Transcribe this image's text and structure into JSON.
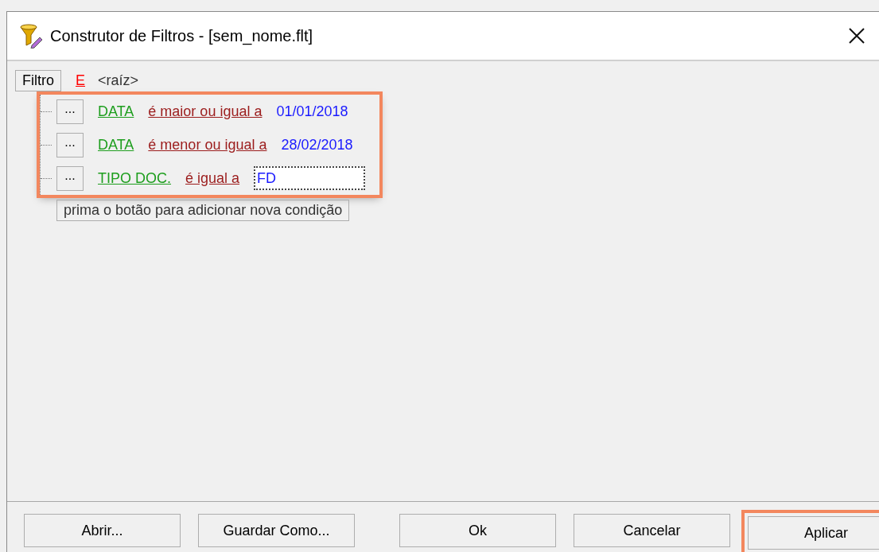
{
  "window": {
    "title": "Construtor de Filtros - [sem_nome.flt]"
  },
  "root": {
    "label": "Filtro",
    "operator": "E",
    "name": "<raíz>"
  },
  "conditions": {
    "highlighted": true,
    "items": [
      {
        "kind": "text",
        "button": "...",
        "field": "DATA",
        "operator": "é maior ou igual a",
        "value": "01/01/2018"
      },
      {
        "kind": "text",
        "button": "...",
        "field": "DATA",
        "operator": "é menor ou igual a",
        "value": "28/02/2018"
      },
      {
        "kind": "input",
        "button": "...",
        "field": "TIPO DOC.",
        "operator": "é igual a",
        "value": "FD"
      }
    ]
  },
  "add_hint": "prima o botão para adicionar nova condição",
  "buttons": [
    {
      "label": "Abrir...",
      "highlighted": false
    },
    {
      "label": "Guardar Como...",
      "highlighted": false
    },
    {
      "label": "Ok",
      "highlighted": false
    },
    {
      "label": "Cancelar",
      "highlighted": false
    },
    {
      "label": "Aplicar",
      "highlighted": true
    }
  ]
}
